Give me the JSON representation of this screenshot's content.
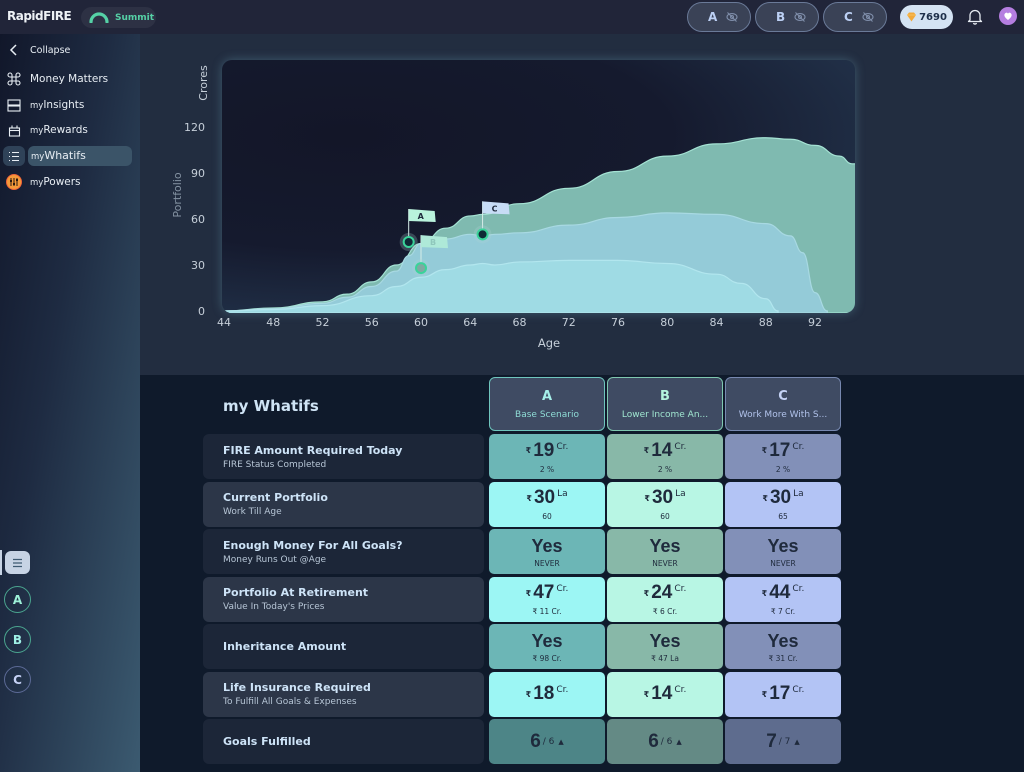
{
  "app": {
    "brand": "RapidFIRE",
    "level": "Summit",
    "coins": "7690"
  },
  "topbar": {
    "scenario_toggles": [
      {
        "letter": "A",
        "icon": "eye-off-icon"
      },
      {
        "letter": "B",
        "icon": "eye-off-icon"
      },
      {
        "letter": "C",
        "icon": "eye-off-icon"
      }
    ]
  },
  "sidebar": {
    "collapse_label": "Collapse",
    "items": [
      {
        "prefix": "",
        "label": "Money Matters",
        "icon": "command-icon"
      },
      {
        "prefix": "my",
        "label": "Insights",
        "icon": "layout-icon"
      },
      {
        "prefix": "my",
        "label": "Rewards",
        "icon": "gift-icon"
      },
      {
        "prefix": "my",
        "label": "Whatifs",
        "icon": "list-icon",
        "active": true
      },
      {
        "prefix": "my",
        "label": "Powers",
        "icon": "sliders-icon"
      }
    ],
    "scenario_buttons": [
      "A",
      "B",
      "C"
    ]
  },
  "colors": {
    "scenario_a": "#8be8e4",
    "scenario_b": "#9de9cf",
    "scenario_c": "#b4c5f4",
    "accent_green": "#55d1a6"
  },
  "chart_data": {
    "type": "area",
    "title": "",
    "xlabel": "Age",
    "ylabel": "Portfolio",
    "yunit": "Crores",
    "xlim": [
      44,
      95
    ],
    "ylim": [
      0,
      135
    ],
    "xticks": [
      44,
      48,
      52,
      56,
      60,
      64,
      68,
      72,
      76,
      80,
      84,
      88,
      92
    ],
    "yticks": [
      0,
      30,
      60,
      90,
      120
    ],
    "grid": false,
    "series": [
      {
        "name": "C",
        "x": [
          44,
          48,
          52,
          54,
          56,
          58,
          60,
          62,
          64,
          65,
          68,
          72,
          76,
          80,
          84,
          88,
          90,
          92,
          94,
          95
        ],
        "values": [
          0,
          2,
          6,
          11,
          19,
          30,
          44,
          54,
          62,
          63,
          70,
          80,
          91,
          101,
          109,
          113,
          112,
          108,
          101,
          96
        ]
      },
      {
        "name": "A",
        "x": [
          44,
          48,
          52,
          54,
          56,
          58,
          59,
          60,
          62,
          64,
          65,
          66,
          68,
          72,
          76,
          80,
          84,
          88,
          90,
          91,
          92,
          93
        ],
        "values": [
          0,
          1.5,
          5,
          9,
          16,
          26,
          36,
          44,
          47,
          50,
          49,
          50,
          51,
          56,
          61,
          64,
          63,
          57,
          49,
          38,
          12,
          0
        ]
      },
      {
        "name": "B",
        "x": [
          44,
          48,
          52,
          56,
          58,
          60,
          62,
          64,
          65,
          66,
          68,
          72,
          76,
          80,
          84,
          86,
          88,
          89
        ],
        "values": [
          0,
          1,
          3.5,
          10,
          16,
          22,
          27,
          30,
          31,
          30,
          32,
          33,
          33,
          31,
          24,
          18,
          8,
          0
        ]
      }
    ],
    "markers": [
      {
        "label": "A",
        "age": 59,
        "value": 45
      },
      {
        "label": "B",
        "age": 60,
        "value": 28
      },
      {
        "label": "C",
        "age": 65,
        "value": 50
      }
    ]
  },
  "whatifs": {
    "title": "my Whatifs",
    "columns": [
      {
        "letter": "A",
        "name": "Base Scenario"
      },
      {
        "letter": "B",
        "name": "Lower Income An..."
      },
      {
        "letter": "C",
        "name": "Work More With S..."
      }
    ],
    "rows": [
      {
        "title": "FIRE Amount Required Today",
        "subtitle": "FIRE Status Completed",
        "kind": "money",
        "cells": [
          {
            "cur": "₹",
            "num": "19",
            "unit": "Cr.",
            "sub": "2 %"
          },
          {
            "cur": "₹",
            "num": "14",
            "unit": "Cr.",
            "sub": "2 %"
          },
          {
            "cur": "₹",
            "num": "17",
            "unit": "Cr.",
            "sub": "2 %"
          }
        ]
      },
      {
        "title": "Current Portfolio",
        "subtitle": "Work Till Age",
        "kind": "money",
        "cells": [
          {
            "cur": "₹",
            "num": "30",
            "unit": "La",
            "sub": "60"
          },
          {
            "cur": "₹",
            "num": "30",
            "unit": "La",
            "sub": "60"
          },
          {
            "cur": "₹",
            "num": "30",
            "unit": "La",
            "sub": "65"
          }
        ]
      },
      {
        "title": "Enough Money For All Goals?",
        "subtitle": "Money Runs Out @Age",
        "kind": "yes",
        "cells": [
          {
            "num": "Yes",
            "sub": "NEVER"
          },
          {
            "num": "Yes",
            "sub": "NEVER"
          },
          {
            "num": "Yes",
            "sub": "NEVER"
          }
        ]
      },
      {
        "title": "Portfolio At Retirement",
        "subtitle": "Value In Today's Prices",
        "kind": "money",
        "cells": [
          {
            "cur": "₹",
            "num": "47",
            "unit": "Cr.",
            "sub": "₹ 11 Cr."
          },
          {
            "cur": "₹",
            "num": "24",
            "unit": "Cr.",
            "sub": "₹ 6 Cr."
          },
          {
            "cur": "₹",
            "num": "44",
            "unit": "Cr.",
            "sub": "₹ 7 Cr."
          }
        ]
      },
      {
        "title": "Inheritance Amount",
        "subtitle": "",
        "kind": "yes",
        "cells": [
          {
            "num": "Yes",
            "sub": "₹ 98 Cr."
          },
          {
            "num": "Yes",
            "sub": "₹ 47 La"
          },
          {
            "num": "Yes",
            "sub": "₹ 31 Cr."
          }
        ]
      },
      {
        "title": "Life Insurance Required",
        "subtitle": "To Fulfill All Goals & Expenses",
        "kind": "money",
        "cells": [
          {
            "cur": "₹",
            "num": "18",
            "unit": "Cr.",
            "sub": ""
          },
          {
            "cur": "₹",
            "num": "14",
            "unit": "Cr.",
            "sub": ""
          },
          {
            "cur": "₹",
            "num": "17",
            "unit": "Cr.",
            "sub": ""
          }
        ]
      },
      {
        "title": "Goals Fulfilled",
        "subtitle": "",
        "kind": "goals",
        "cells": [
          {
            "num": "6",
            "den": "/ 6",
            "icon": "caret-up-icon"
          },
          {
            "num": "6",
            "den": "/ 6",
            "icon": "caret-up-icon"
          },
          {
            "num": "7",
            "den": "/ 7",
            "icon": "caret-up-icon"
          }
        ]
      }
    ]
  }
}
